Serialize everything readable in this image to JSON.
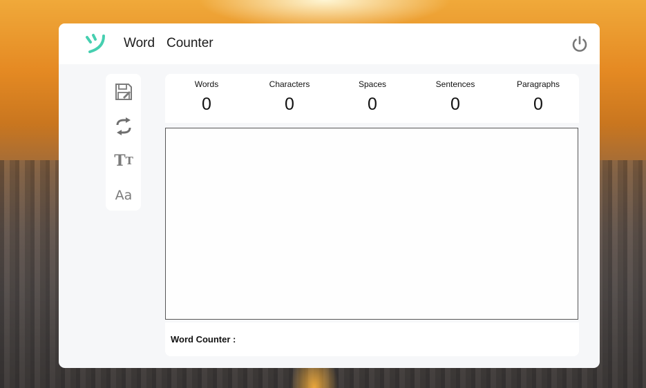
{
  "app": {
    "title_word": "Word",
    "title_counter": "Counter",
    "logo_icon": "smile-wink-logo",
    "accent_color": "#46cfb0"
  },
  "toolbar": {
    "items": [
      {
        "name": "save-icon"
      },
      {
        "name": "refresh-icon"
      },
      {
        "name": "text-size-icon",
        "glyph_big": "T",
        "glyph_small": "T"
      },
      {
        "name": "font-case-icon",
        "glyph": "Aa"
      }
    ]
  },
  "stats": [
    {
      "label": "Words",
      "value": "0"
    },
    {
      "label": "Characters",
      "value": "0"
    },
    {
      "label": "Spaces",
      "value": "0"
    },
    {
      "label": "Sentences",
      "value": "0"
    },
    {
      "label": "Paragraphs",
      "value": "0"
    }
  ],
  "editor": {
    "value": "",
    "placeholder": ""
  },
  "footer": {
    "label": "Word Counter :"
  }
}
